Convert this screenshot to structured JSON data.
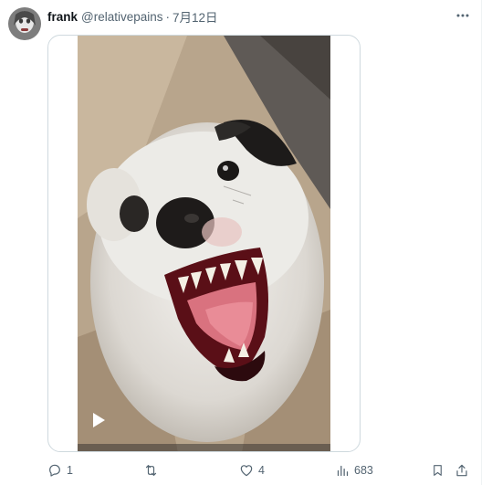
{
  "post": {
    "display_name": "frank",
    "handle": "@relativepains",
    "separator": "·",
    "date": "7月12日"
  },
  "media": {
    "type": "video"
  },
  "actions": {
    "reply_count": "1",
    "repost_count": "",
    "like_count": "4",
    "view_count": "683"
  },
  "icons": [
    "more-icon",
    "play-icon",
    "reply-icon",
    "repost-icon",
    "like-icon",
    "views-icon",
    "bookmark-icon",
    "share-icon"
  ],
  "colors": {
    "text_primary": "#0f1419",
    "text_secondary": "#536471",
    "border": "#cfd9de"
  }
}
